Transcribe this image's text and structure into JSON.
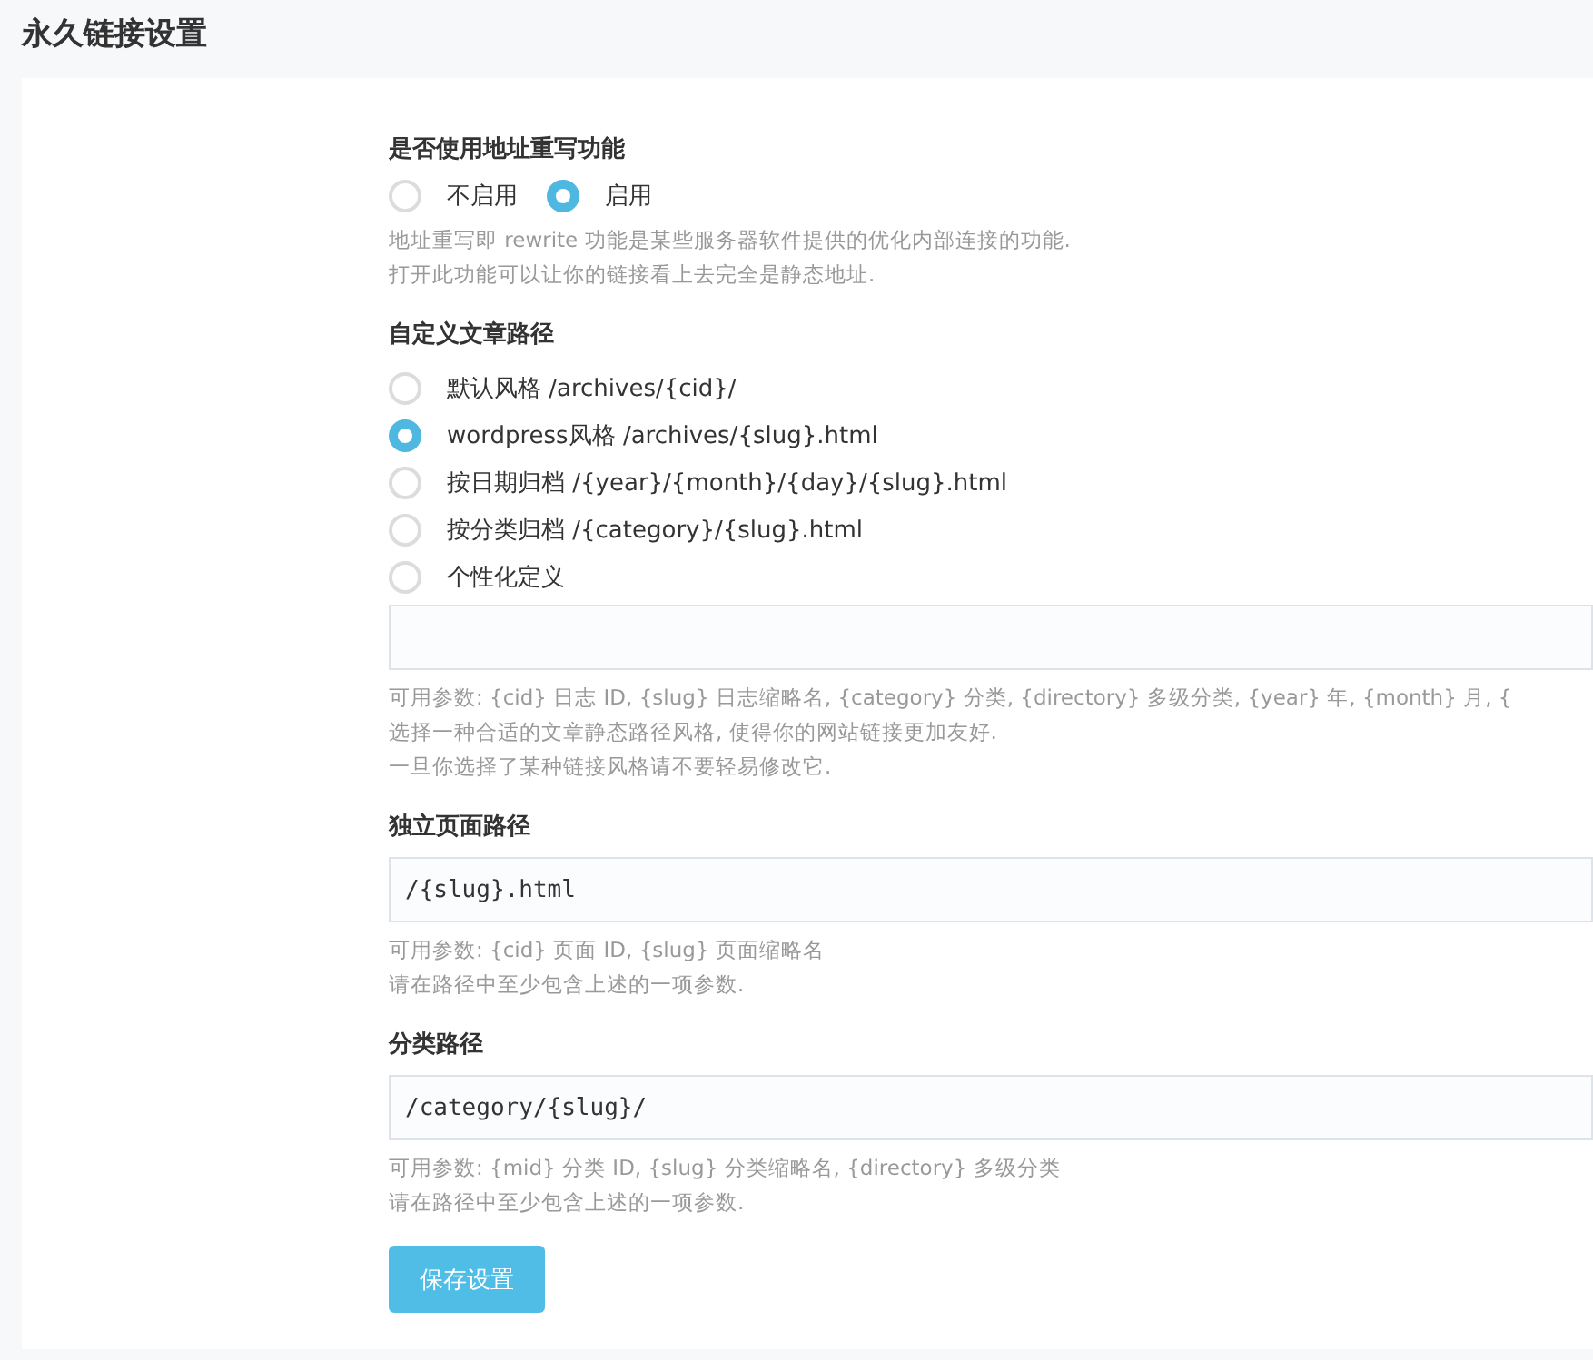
{
  "page_title": "永久链接设置",
  "rewrite": {
    "label": "是否使用地址重写功能",
    "options": [
      {
        "label": "不启用",
        "selected": false
      },
      {
        "label": "启用",
        "selected": true
      }
    ],
    "hints": [
      "地址重写即 rewrite 功能是某些服务器软件提供的优化内部连接的功能.",
      "打开此功能可以让你的链接看上去完全是静态地址."
    ]
  },
  "post_path": {
    "label": "自定义文章路径",
    "options": [
      {
        "label": "默认风格",
        "path": "/archives/{cid}/",
        "selected": false
      },
      {
        "label": "wordpress风格",
        "path": "/archives/{slug}.html",
        "selected": true
      },
      {
        "label": "按日期归档",
        "path": "/{year}/{month}/{day}/{slug}.html",
        "selected": false
      },
      {
        "label": "按分类归档",
        "path": "/{category}/{slug}.html",
        "selected": false
      },
      {
        "label": "个性化定义",
        "selected": false
      }
    ],
    "hints": [
      "可用参数: {cid} 日志 ID, {slug} 日志缩略名, {category} 分类, {directory} 多级分类, {year} 年, {month} 月, {",
      "选择一种合适的文章静态路径风格, 使得你的网站链接更加友好.",
      "一旦你选择了某种链接风格请不要轻易修改它."
    ]
  },
  "page_path": {
    "label": "独立页面路径",
    "value": "/{slug}.html",
    "hints": [
      "可用参数: {cid} 页面 ID, {slug} 页面缩略名",
      "请在路径中至少包含上述的一项参数."
    ]
  },
  "category_path": {
    "label": "分类路径",
    "value": "/category/{slug}/",
    "hints": [
      "可用参数: {mid} 分类 ID, {slug} 分类缩略名, {directory} 多级分类",
      "请在路径中至少包含上述的一项参数."
    ]
  },
  "save_button": "保存设置"
}
